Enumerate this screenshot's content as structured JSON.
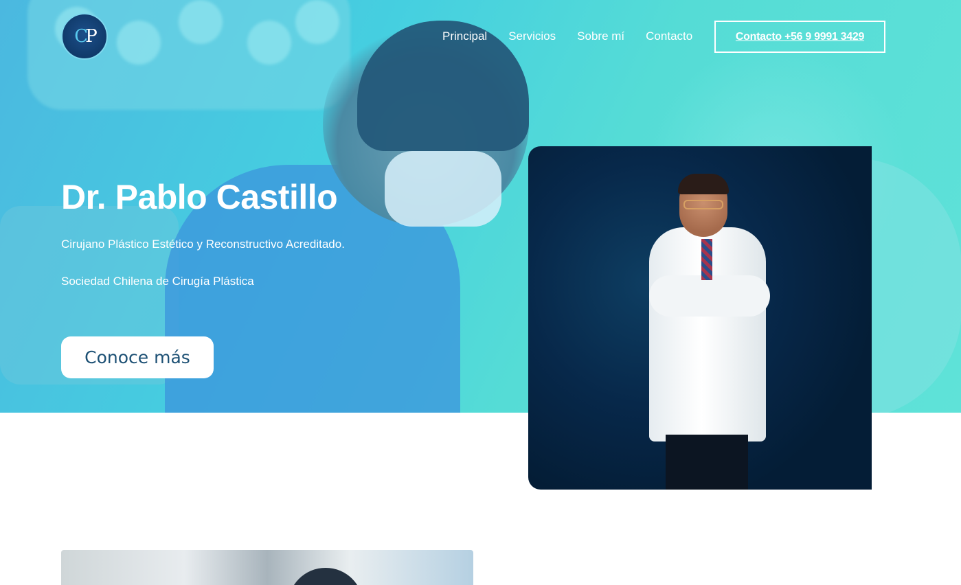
{
  "header": {
    "logo_alt": "Pablo Castillo Cirugía Plástica",
    "nav": [
      {
        "label": "Principal"
      },
      {
        "label": "Servicios"
      },
      {
        "label": "Sobre mí"
      },
      {
        "label": "Contacto"
      }
    ],
    "cta_label": "Contacto +56 9 9991 3429"
  },
  "hero": {
    "title": "Dr. Pablo Castillo",
    "subtitle_1": "Cirujano Plástico Estético y Reconstructivo Acreditado.",
    "subtitle_2": "Sociedad Chilena de Cirugía Plástica",
    "button_label": "Conoce más"
  },
  "colors": {
    "hero_gradient_start": "#4bb8e0",
    "hero_gradient_end": "#5fe2d8",
    "button_text": "#1c5074",
    "portrait_bg": "#07284a"
  }
}
